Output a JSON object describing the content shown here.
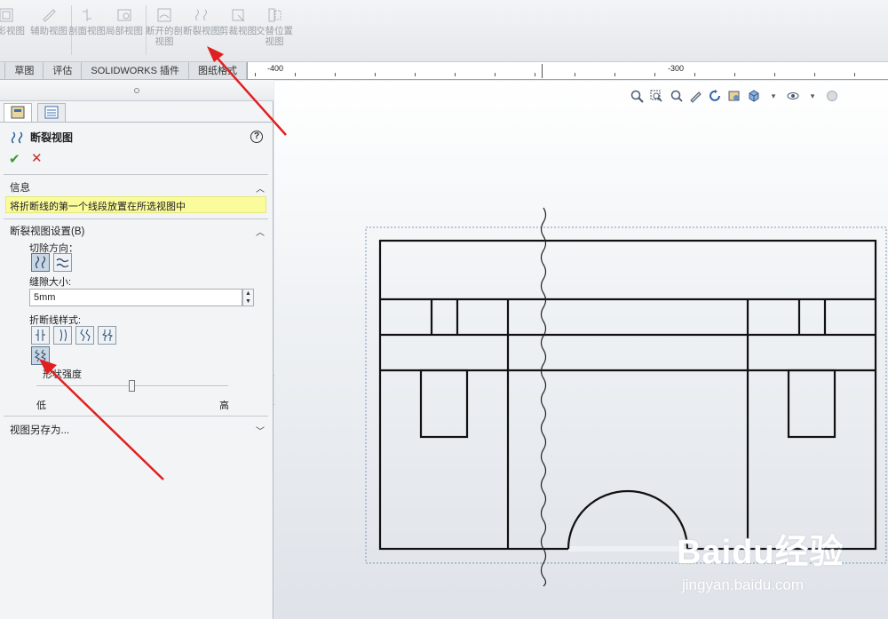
{
  "ribbon": {
    "buttons": [
      {
        "label": "投影视图",
        "icon": "projected-view-icon"
      },
      {
        "label": "辅助视图",
        "icon": "auxiliary-view-icon"
      },
      {
        "label": "剖面视图",
        "icon": "section-view-icon"
      },
      {
        "label": "局部视图",
        "icon": "detail-view-icon"
      },
      {
        "label": "断开的剖视图",
        "icon": "broken-out-section-icon"
      },
      {
        "label": "断裂视图",
        "icon": "break-view-icon"
      },
      {
        "label": "剪裁视图",
        "icon": "crop-view-icon"
      },
      {
        "label": "交替位置视图",
        "icon": "alternate-position-view-icon"
      }
    ]
  },
  "tabs": [
    "草图",
    "评估",
    "SOLIDWORKS 插件",
    "图纸格式"
  ],
  "ruler": {
    "labels": [
      "-400",
      "-300"
    ]
  },
  "panel": {
    "title": "断裂视图",
    "help": "?",
    "ok": "✔",
    "cancel": "✕",
    "info_section": "信息",
    "info_message": "将折断线的第一个线段放置在所选视图中",
    "settings_section": "断裂视图设置(B)",
    "cut_direction_label": "切除方向：",
    "gap_label": "缝隙大小:",
    "gap_value": "5mm",
    "break_style_label": "折断线样式:",
    "shape_intensity_label": "形状强度",
    "slider_low": "低",
    "slider_high": "高",
    "slider_value": 0.5,
    "save_as_section": "视图另存为..."
  },
  "watermark": {
    "main": "Baidu经验",
    "sub": "jingyan.baidu.com"
  },
  "colors": {
    "highlight": "#fafb9a",
    "arrow": "#e02020",
    "ok": "#3a9a30",
    "cancel": "#d02a2a"
  }
}
